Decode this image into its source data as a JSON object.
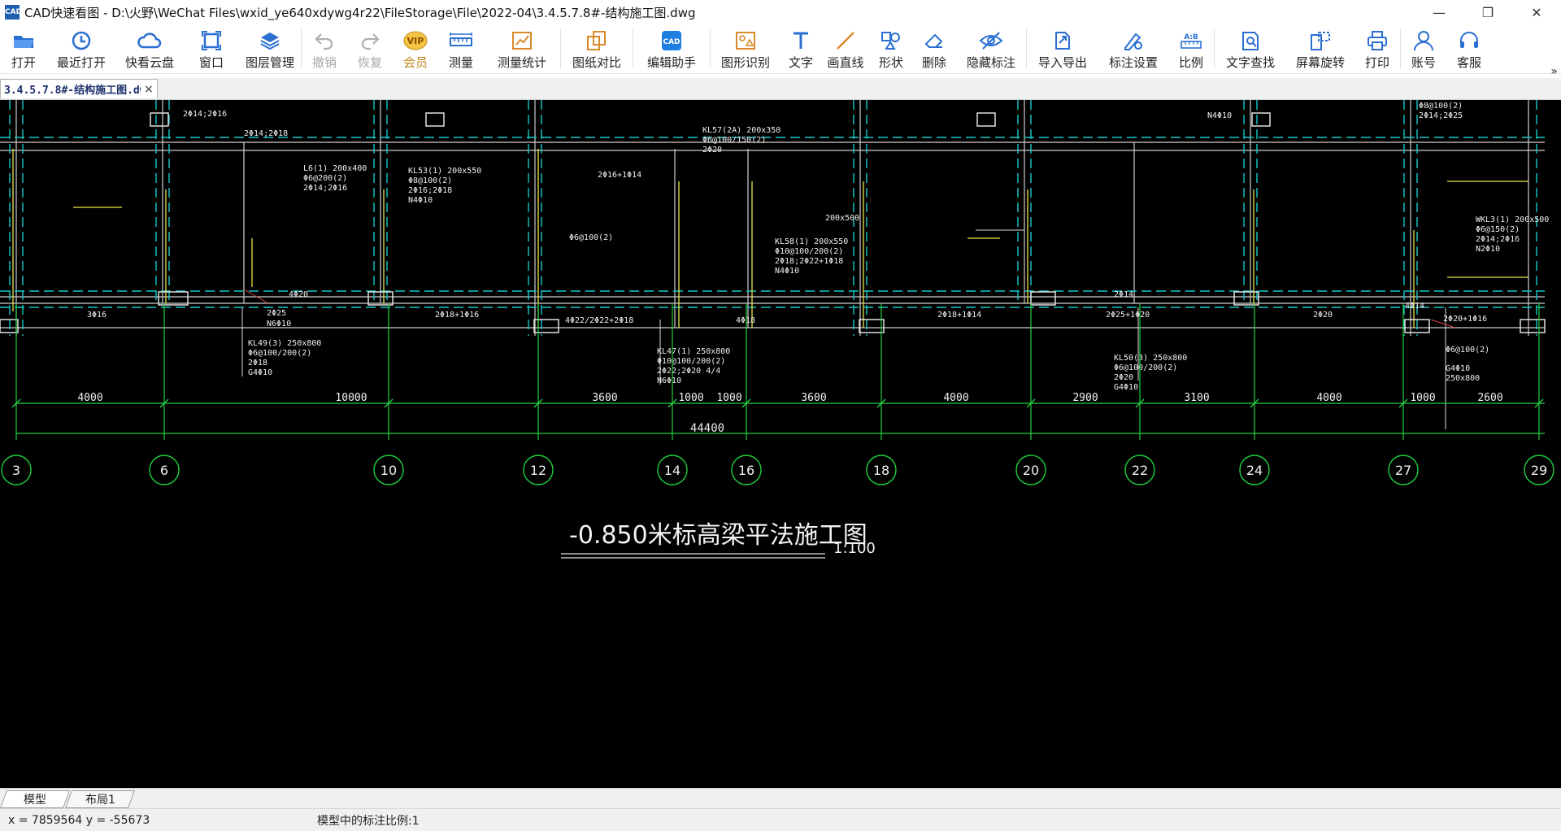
{
  "window": {
    "app_logo": "CAD",
    "title": "CAD快速看图 - D:\\火野\\WeChat Files\\wxid_ye640xdywg4r22\\FileStorage\\File\\2022-04\\3.4.5.7.8#-结构施工图.dwg",
    "minimize": "—",
    "restore": "❐",
    "close": "✕"
  },
  "toolbar": {
    "items": [
      {
        "id": "open",
        "label": "打开",
        "icon": "folder-open-icon"
      },
      {
        "id": "recent",
        "label": "最近打开",
        "icon": "clock-icon"
      },
      {
        "id": "cloud",
        "label": "快看云盘",
        "icon": "cloud-icon"
      },
      {
        "id": "window",
        "label": "窗口",
        "icon": "window-icon"
      },
      {
        "id": "layers",
        "label": "图层管理",
        "icon": "layers-icon"
      },
      {
        "id": "undo",
        "label": "撤销",
        "icon": "undo-icon",
        "disabled": true
      },
      {
        "id": "redo",
        "label": "恢复",
        "icon": "redo-icon",
        "disabled": true
      },
      {
        "id": "vip",
        "label": "会员",
        "icon": "vip-icon"
      },
      {
        "id": "measure",
        "label": "测量",
        "icon": "ruler-icon"
      },
      {
        "id": "measure-stats",
        "label": "测量统计",
        "icon": "chart-icon"
      },
      {
        "id": "compare",
        "label": "图纸对比",
        "icon": "compare-icon"
      },
      {
        "id": "edit",
        "label": "编辑助手",
        "icon": "edit-icon"
      },
      {
        "id": "recognize",
        "label": "图形识别",
        "icon": "shape-recognize-icon"
      },
      {
        "id": "text",
        "label": "文字",
        "icon": "text-icon"
      },
      {
        "id": "line",
        "label": "画直线",
        "icon": "line-icon"
      },
      {
        "id": "shape",
        "label": "形状",
        "icon": "shape-icon"
      },
      {
        "id": "delete",
        "label": "删除",
        "icon": "eraser-icon"
      },
      {
        "id": "hide",
        "label": "隐藏标注",
        "icon": "eye-hide-icon"
      },
      {
        "id": "export",
        "label": "导入导出",
        "icon": "export-icon"
      },
      {
        "id": "annot",
        "label": "标注设置",
        "icon": "annotation-settings-icon"
      },
      {
        "id": "ratio",
        "label": "比例",
        "icon": "ratio-icon"
      },
      {
        "id": "findtext",
        "label": "文字查找",
        "icon": "find-text-icon"
      },
      {
        "id": "rotate",
        "label": "屏幕旋转",
        "icon": "rotate-icon"
      },
      {
        "id": "print",
        "label": "打印",
        "icon": "printer-icon"
      },
      {
        "id": "account",
        "label": "账号",
        "icon": "user-icon"
      },
      {
        "id": "service",
        "label": "客服",
        "icon": "headset-icon"
      }
    ],
    "more": "»"
  },
  "doc_tab": {
    "label": "3.4.5.7.8#-结构施工图.dwg",
    "close": "×"
  },
  "drawing": {
    "axis_labels": [
      "3",
      "6",
      "10",
      "12",
      "14",
      "16",
      "18",
      "20",
      "22",
      "24",
      "27",
      "29"
    ],
    "spans": [
      "4000",
      "10000",
      "3600",
      "1000",
      "1000",
      "3600",
      "4000",
      "2900",
      "3100",
      "4000",
      "1000",
      "2600"
    ],
    "total": "44400",
    "title": "-0.850米标高梁平法施工图",
    "scale": "1:100",
    "annotations": [
      "KL49(3) 250x800",
      "Φ6@100/200(2)",
      "2Φ18",
      "G4Φ10",
      "KL47(1) 250x800",
      "Φ10@100/200(2)",
      "2Φ22;2Φ20 4/4",
      "N6Φ10",
      "KL50(3) 250x800",
      "Φ6@100/200(2)",
      "2Φ20",
      "G4Φ10",
      "KL57(2A) 200x350",
      "Φ6@100/150(2)",
      "2Φ20",
      "KL58(1) 200x550",
      "Φ10@100/200(2)",
      "2Φ18;2Φ22+1Φ18",
      "N4Φ10",
      "KL53(1) 200x550",
      "Φ8@100(2)",
      "2Φ16;2Φ18",
      "N4Φ10",
      "L6(1) 200x400",
      "Φ6@200(2)",
      "2Φ14;2Φ16",
      "WKL3(1) 200x500",
      "Φ6@150(2)",
      "2Φ14;2Φ16",
      "N2Φ10",
      "Φ8@100(2)",
      "2Φ14;2Φ25",
      "N4Φ10",
      "Φ6@100(2)",
      "G4Φ10",
      "250x800",
      "200x500",
      "Φ6@100(2)",
      "2Φ25",
      "N6Φ10",
      "3Φ16",
      "2Φ18+1Φ16",
      "2Φ18+1Φ14",
      "2Φ20",
      "2Φ25+1Φ20",
      "4Φ22/2Φ22+2Φ18",
      "4Φ18",
      "4Φ20",
      "2Φ14",
      "4Φ14",
      "2Φ20+1Φ16",
      "2Φ16+1Φ14",
      "2Φ14;2Φ18",
      "2Φ14;2Φ16"
    ]
  },
  "layout_tabs": [
    "模型",
    "布局1"
  ],
  "status": {
    "coords": "x = 7859564  y = -55673",
    "scale_text": "模型中的标注比例:1"
  }
}
